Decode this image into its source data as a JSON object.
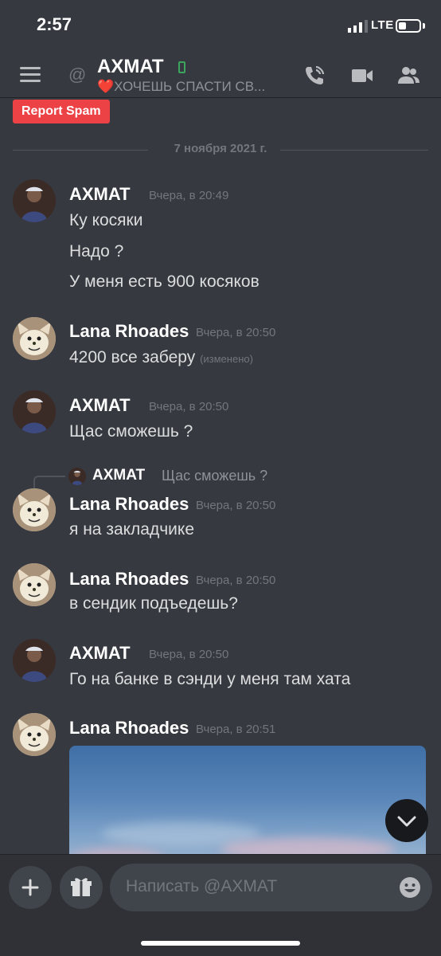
{
  "status_bar": {
    "time": "2:57",
    "network": "LTE"
  },
  "header": {
    "title": "AXMAT",
    "status_emoji": "❤️",
    "status_text": "ХОЧЕШЬ СПАСТИ СВ...",
    "icons": [
      "hamburger-icon",
      "at-icon",
      "mobile-icon",
      "call-icon",
      "video-icon",
      "members-icon"
    ]
  },
  "report_spam": "Report Spam",
  "date_divider": "7 ноября 2021 г.",
  "messages": [
    {
      "author": "AXMAT",
      "timestamp": "Вчера, в 20:49",
      "lines": [
        "Ку косяки",
        "Надо ?",
        "У меня есть 900 косяков"
      ]
    },
    {
      "author": "Lana Rhoades",
      "timestamp": "Вчера, в 20:50",
      "lines": [
        "4200 все заберу"
      ],
      "edited": "(изменено)"
    },
    {
      "author": "AXMAT",
      "timestamp": "Вчера, в 20:50",
      "lines": [
        "Щас сможешь ?"
      ]
    },
    {
      "author": "Lana Rhoades",
      "timestamp": "Вчера, в 20:50",
      "lines": [
        "я на закладчике"
      ],
      "reply": {
        "author": "AXMAT",
        "text": "Щас сможешь ?"
      }
    },
    {
      "author": "Lana Rhoades",
      "timestamp": "Вчера, в 20:50",
      "lines": [
        "в сендик подъедешь?"
      ]
    },
    {
      "author": "AXMAT",
      "timestamp": "Вчера, в 20:50",
      "lines": [
        "Го на банке в сэнди у меня там хата"
      ]
    },
    {
      "author": "Lana Rhoades",
      "timestamp": "Вчера, в 20:51",
      "lines": []
    }
  ],
  "composer": {
    "placeholder": "Написать @AXMAT"
  },
  "colors": {
    "background": "#36393f",
    "composer": "#2f3136",
    "accent_red": "#ed4245",
    "online_green": "#3ba55d"
  }
}
